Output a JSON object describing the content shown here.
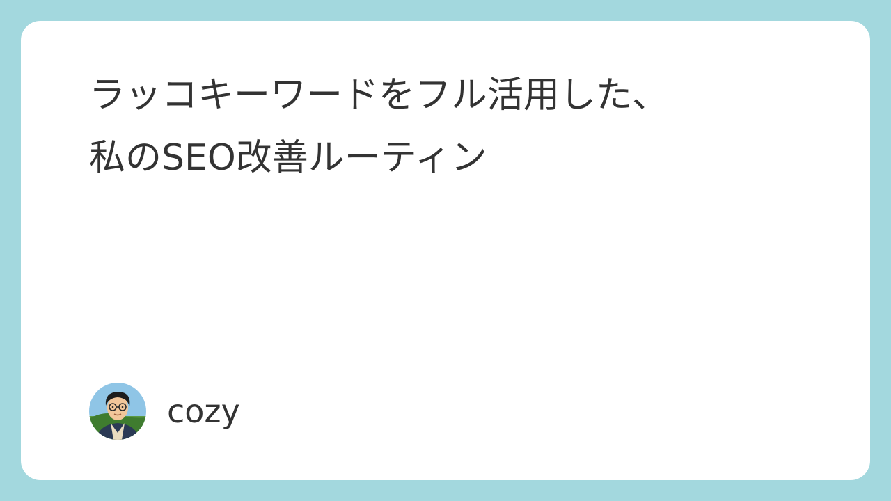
{
  "title_lines": [
    "ラッコキーワードをフル活用した、",
    "私のSEO改善ルーティン"
  ],
  "author": {
    "name": "cozy",
    "avatar_icon": "person-avatar-illustration"
  },
  "colors": {
    "background": "#a3d8de",
    "card": "#ffffff",
    "text": "#333333"
  }
}
